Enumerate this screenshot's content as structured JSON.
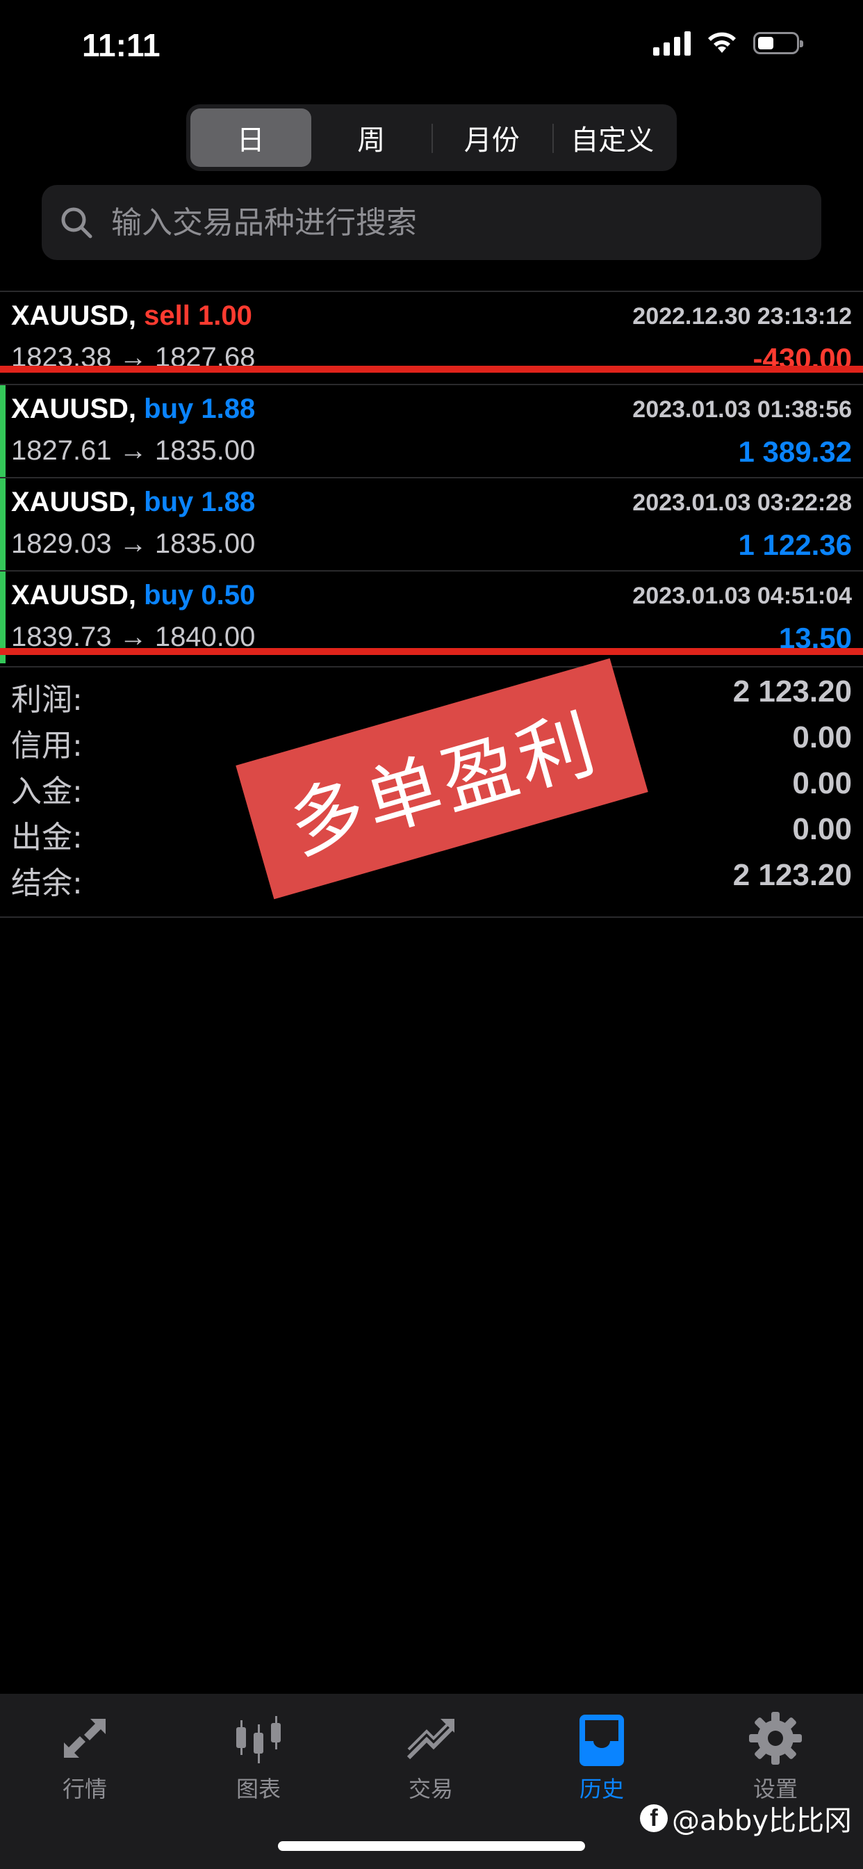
{
  "status_bar": {
    "time": "11:11"
  },
  "period_tabs": [
    {
      "label": "日",
      "active": true
    },
    {
      "label": "周",
      "active": false
    },
    {
      "label": "月份",
      "active": false
    },
    {
      "label": "自定义",
      "active": false
    }
  ],
  "search": {
    "placeholder": "输入交易品种进行搜索",
    "value": ""
  },
  "trades": [
    {
      "symbol": "XAUUSD,",
      "type": "sell",
      "volume": "1.00",
      "time": "2022.12.30 23:13:12",
      "prices": "1823.38 → 1827.68",
      "profit": "-430.00"
    },
    {
      "symbol": "XAUUSD,",
      "type": "buy",
      "volume": "1.88",
      "time": "2023.01.03 01:38:56",
      "prices": "1827.61 → 1835.00",
      "profit": "1 389.32"
    },
    {
      "symbol": "XAUUSD,",
      "type": "buy",
      "volume": "1.88",
      "time": "2023.01.03 03:22:28",
      "prices": "1829.03 → 1835.00",
      "profit": "1 122.36"
    },
    {
      "symbol": "XAUUSD,",
      "type": "buy",
      "volume": "0.50",
      "time": "2023.01.03 04:51:04",
      "prices": "1839.73 → 1840.00",
      "profit": "13.50"
    }
  ],
  "summary": [
    {
      "label": "利润:",
      "value": "2 123.20"
    },
    {
      "label": "信用:",
      "value": "0.00"
    },
    {
      "label": "入金:",
      "value": "0.00"
    },
    {
      "label": "出金:",
      "value": "0.00"
    },
    {
      "label": "结余:",
      "value": "2 123.20"
    }
  ],
  "stamp": {
    "text": "多单盈利",
    "color": "#dc4a47"
  },
  "tab_bar": [
    {
      "label": "行情",
      "icon": "arrows-icon",
      "active": false
    },
    {
      "label": "图表",
      "icon": "candlestick-icon",
      "active": false
    },
    {
      "label": "交易",
      "icon": "trend-icon",
      "active": false
    },
    {
      "label": "历史",
      "icon": "inbox-icon",
      "active": true
    },
    {
      "label": "设置",
      "icon": "gear-icon",
      "active": false
    }
  ],
  "watermark": {
    "text": "@abby比比冈",
    "logo": "f"
  },
  "colors": {
    "sell": "#ff3b30",
    "buy": "#0a84ff",
    "profit_bar": "#34c759",
    "active_tab": "#0a84ff",
    "annotation_line": "#e0241b"
  }
}
